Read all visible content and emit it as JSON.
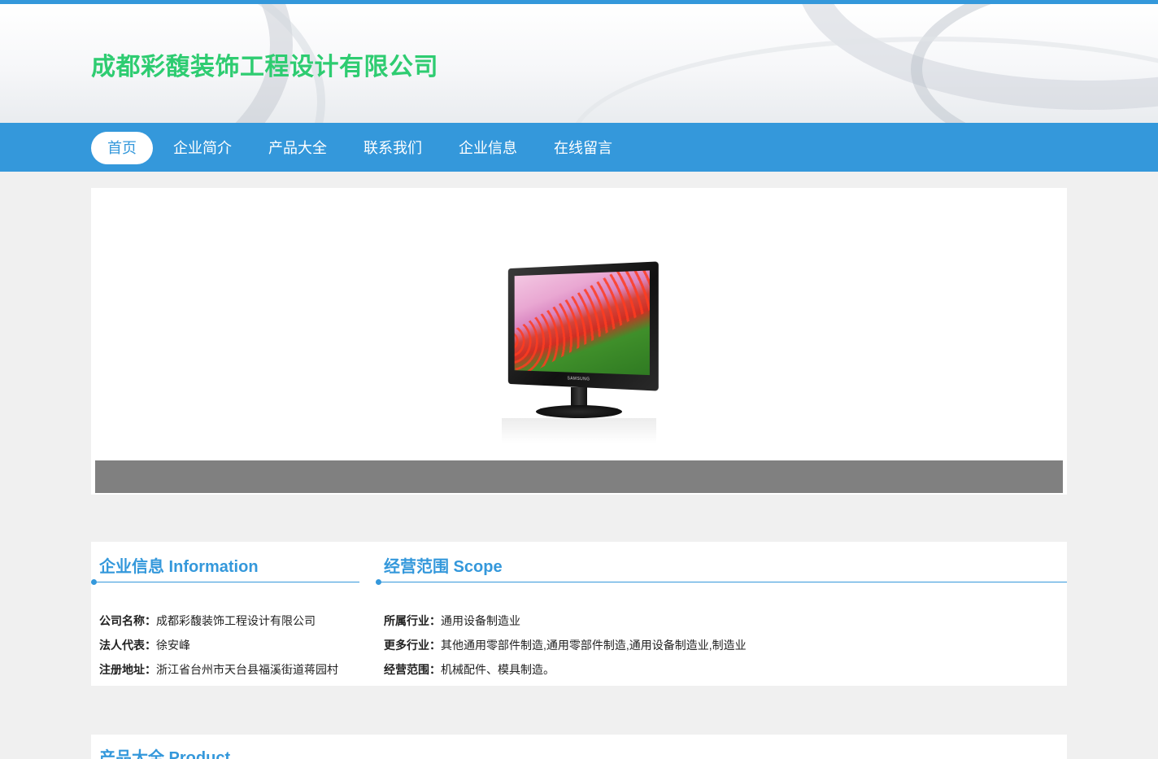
{
  "site": {
    "title": "成都彩馥装饰工程设计有限公司"
  },
  "nav": {
    "items": [
      {
        "label": "首页"
      },
      {
        "label": "企业简介"
      },
      {
        "label": "产品大全"
      },
      {
        "label": "联系我们"
      },
      {
        "label": "企业信息"
      },
      {
        "label": "在线留言"
      }
    ]
  },
  "banner": {
    "brand": "SAMSUNG"
  },
  "info": {
    "title": "企业信息 Information",
    "rows": [
      {
        "label": "公司名称：",
        "value": "成都彩馥装饰工程设计有限公司"
      },
      {
        "label": "法人代表：",
        "value": "徐安峰"
      },
      {
        "label": "注册地址：",
        "value": "浙江省台州市天台县福溪街道蒋园村"
      }
    ]
  },
  "scope": {
    "title": "经营范围 Scope",
    "rows": [
      {
        "label": "所属行业：",
        "value": "通用设备制造业"
      },
      {
        "label": "更多行业：",
        "value": "其他通用零部件制造,通用零部件制造,通用设备制造业,制造业"
      },
      {
        "label": "经营范围：",
        "value": "机械配件、模具制造。"
      }
    ]
  },
  "products": {
    "title": "产品大全 Product"
  },
  "colors": {
    "primary": "#3498db",
    "title_green": "#2ecc71",
    "background": "#f0f0f0"
  }
}
